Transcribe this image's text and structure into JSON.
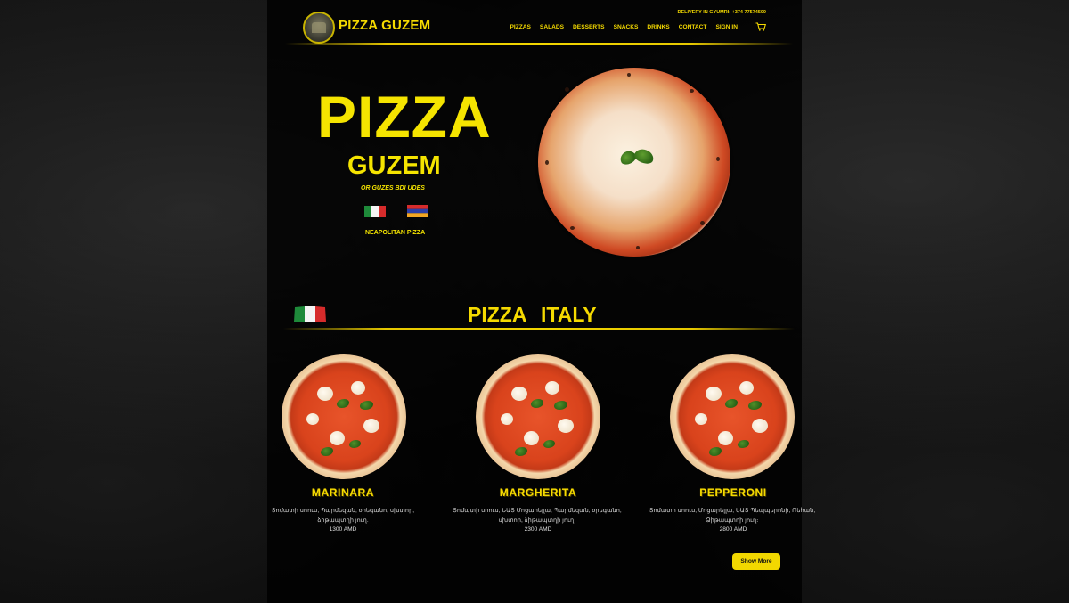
{
  "header": {
    "brand": "PIZZA GUZEM",
    "delivery": "DELIVERY IN GYUMRI: +374 77574500",
    "nav": [
      "PIZZAS",
      "SALADS",
      "DESSERTS",
      "SNACKS",
      "DRINKS",
      "CONTACT",
      "SIGN IN"
    ]
  },
  "hero": {
    "title": "PIZZA",
    "subtitle": "GUZEM",
    "tagline": "OR GUZES BDI UDES",
    "style": "NEAPOLITAN PIZZA"
  },
  "section": {
    "title": "PIZZA ITALY"
  },
  "products": [
    {
      "name": "MARINARA",
      "description": "Տոմատի սոուս, Պարմեզան, օրեգանո, սխտոր,",
      "description2": "ձիթապտղի յուղ.",
      "price": "1300 AMD"
    },
    {
      "name": "MARGHERITA",
      "description": "Տոմատի սոուս, ԵԱՏ Մոցարելլա, Պարմեզան, օրեգանո,",
      "description2": "սխտոր, ձիթապտղի յուղ։",
      "price": "2300 AMD"
    },
    {
      "name": "PEPPERONI",
      "description": "Տոմատի սոուս, Մոցարելլա, ԵԱՏ Պեպպերոնի, Ռեհան,",
      "description2": "Ձիթապտղի յուղ։",
      "price": "2800 AMD"
    }
  ],
  "actions": {
    "show_more": "Show More"
  },
  "colors": {
    "accent": "#f5da00",
    "background": "#0b0b0b"
  },
  "icons": [
    "logo-icon",
    "cart-icon",
    "italy-flag-icon",
    "armenia-flag-icon"
  ]
}
